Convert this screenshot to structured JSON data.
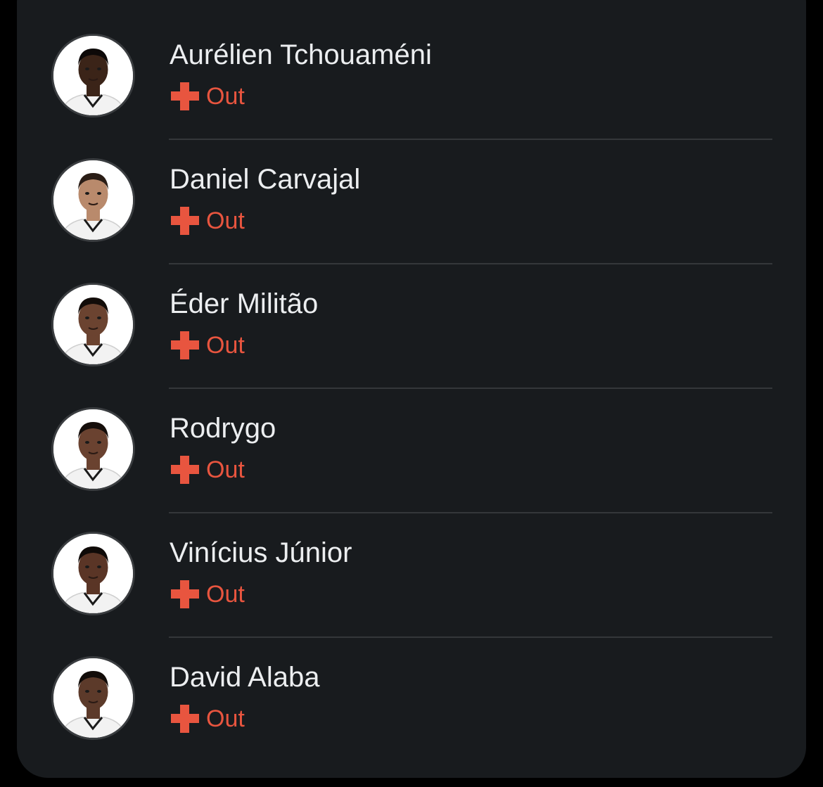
{
  "colors": {
    "background": "#000000",
    "card": "#181b1e",
    "name_text": "#eceef0",
    "status": "#e8553f",
    "divider": "#34373a"
  },
  "players": [
    {
      "name": "Aurélien Tchouaméni",
      "status": "Out",
      "status_icon": "injury-cross-icon",
      "skin": "#3b2418",
      "hair": "#0d0908"
    },
    {
      "name": "Daniel Carvajal",
      "status": "Out",
      "status_icon": "injury-cross-icon",
      "skin": "#b98a6c",
      "hair": "#2a1d16"
    },
    {
      "name": "Éder Militão",
      "status": "Out",
      "status_icon": "injury-cross-icon",
      "skin": "#6b4330",
      "hair": "#120c09"
    },
    {
      "name": "Rodrygo",
      "status": "Out",
      "status_icon": "injury-cross-icon",
      "skin": "#6a4230",
      "hair": "#150e0b"
    },
    {
      "name": "Vinícius Júnior",
      "status": "Out",
      "status_icon": "injury-cross-icon",
      "skin": "#5a3526",
      "hair": "#0f0a08"
    },
    {
      "name": "David Alaba",
      "status": "Out",
      "status_icon": "injury-cross-icon",
      "skin": "#5c3a2a",
      "hair": "#120c09"
    }
  ]
}
